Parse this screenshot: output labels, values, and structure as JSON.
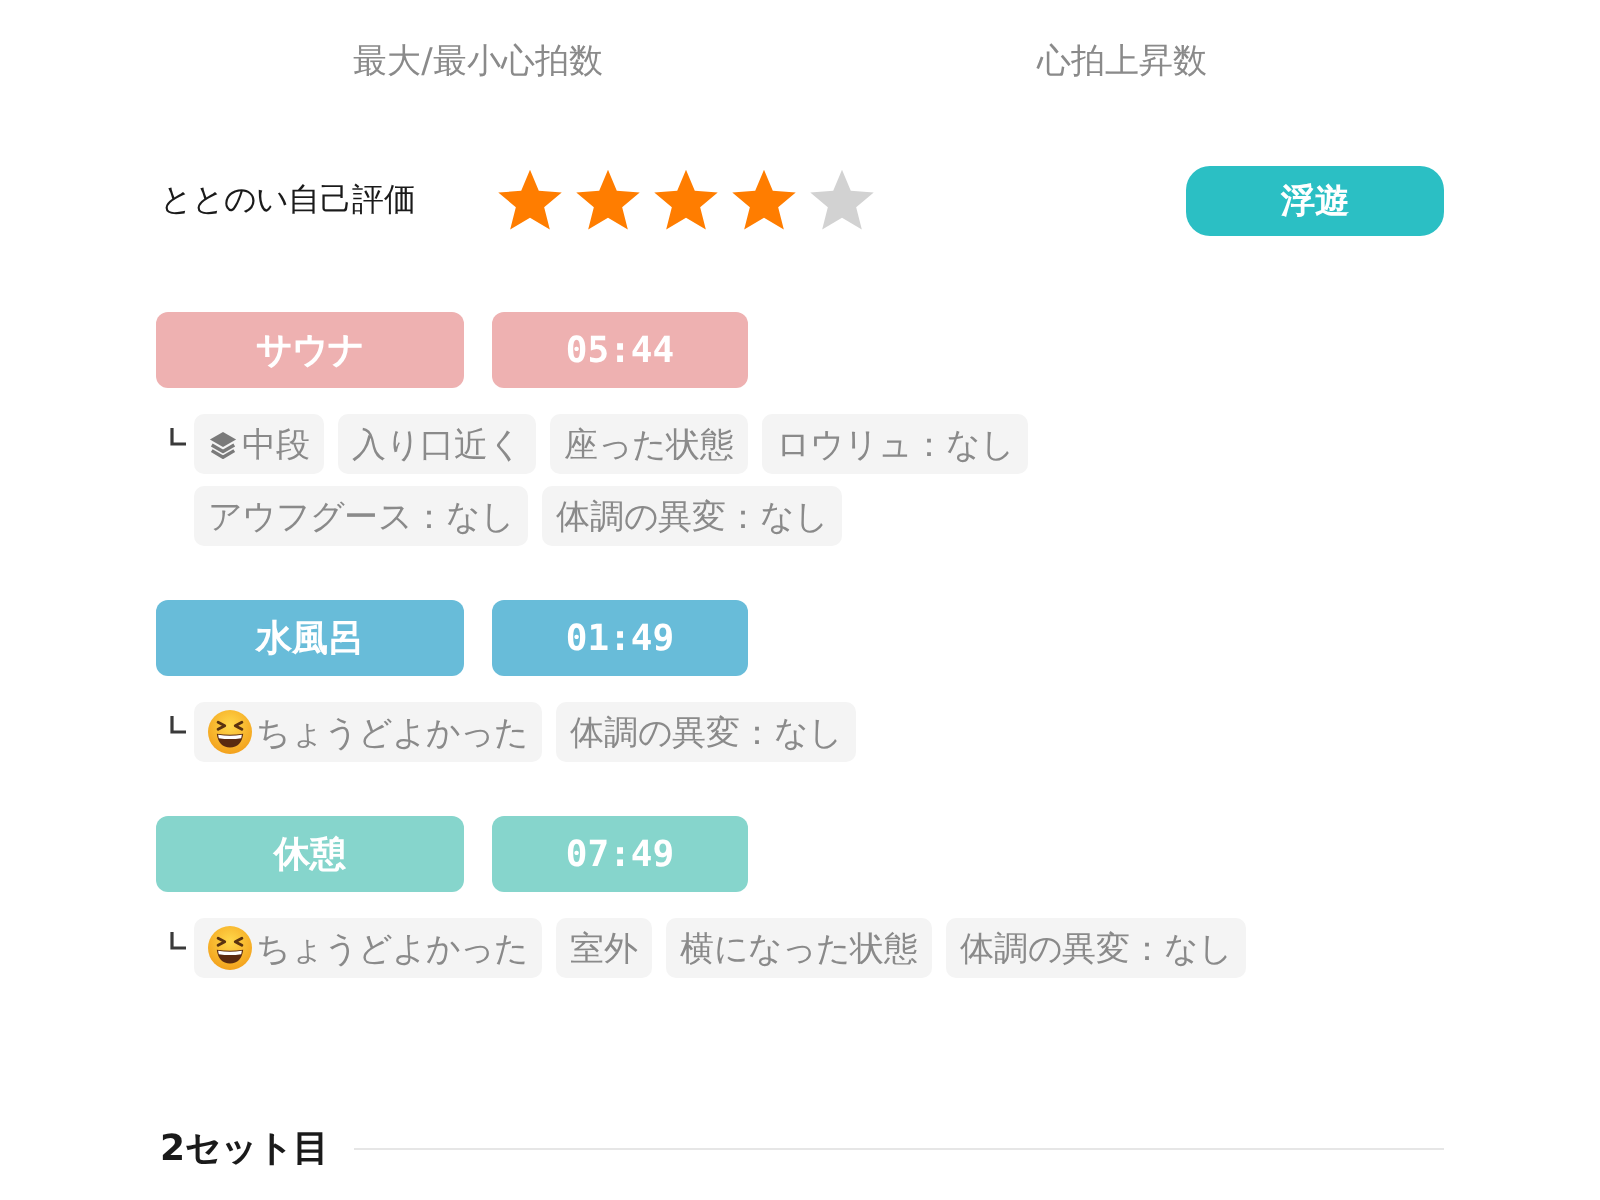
{
  "heart_rate_labels": [
    "最大/最小心拍数",
    "心拍上昇数"
  ],
  "rating": {
    "label": "ととのい自己評価",
    "stars": 4,
    "badge": "浮遊"
  },
  "steps": [
    {
      "name": "サウナ",
      "time": "05:44",
      "color": "#eeb1b1",
      "tags": [
        {
          "kind": "tier",
          "text": "中段"
        },
        {
          "kind": "plain",
          "text": "入り口近く"
        },
        {
          "kind": "plain",
          "text": "座った状態"
        },
        {
          "kind": "plain",
          "text": "ロウリュ：なし"
        },
        {
          "kind": "plain",
          "text": "アウフグース：なし"
        },
        {
          "kind": "plain",
          "text": "体調の異変：なし"
        }
      ]
    },
    {
      "name": "水風呂",
      "time": "01:49",
      "color": "#68bcd9",
      "tags": [
        {
          "kind": "feeling",
          "text": "ちょうどよかった"
        },
        {
          "kind": "plain",
          "text": "体調の異変：なし"
        }
      ]
    },
    {
      "name": "休憩",
      "time": "07:49",
      "color": "#86d5cc",
      "tags": [
        {
          "kind": "feeling",
          "text": "ちょうどよかった"
        },
        {
          "kind": "plain",
          "text": "室外"
        },
        {
          "kind": "plain",
          "text": "横になった状態"
        },
        {
          "kind": "plain",
          "text": "体調の異変：なし"
        }
      ]
    }
  ],
  "next_set": {
    "title": "2セット目"
  }
}
